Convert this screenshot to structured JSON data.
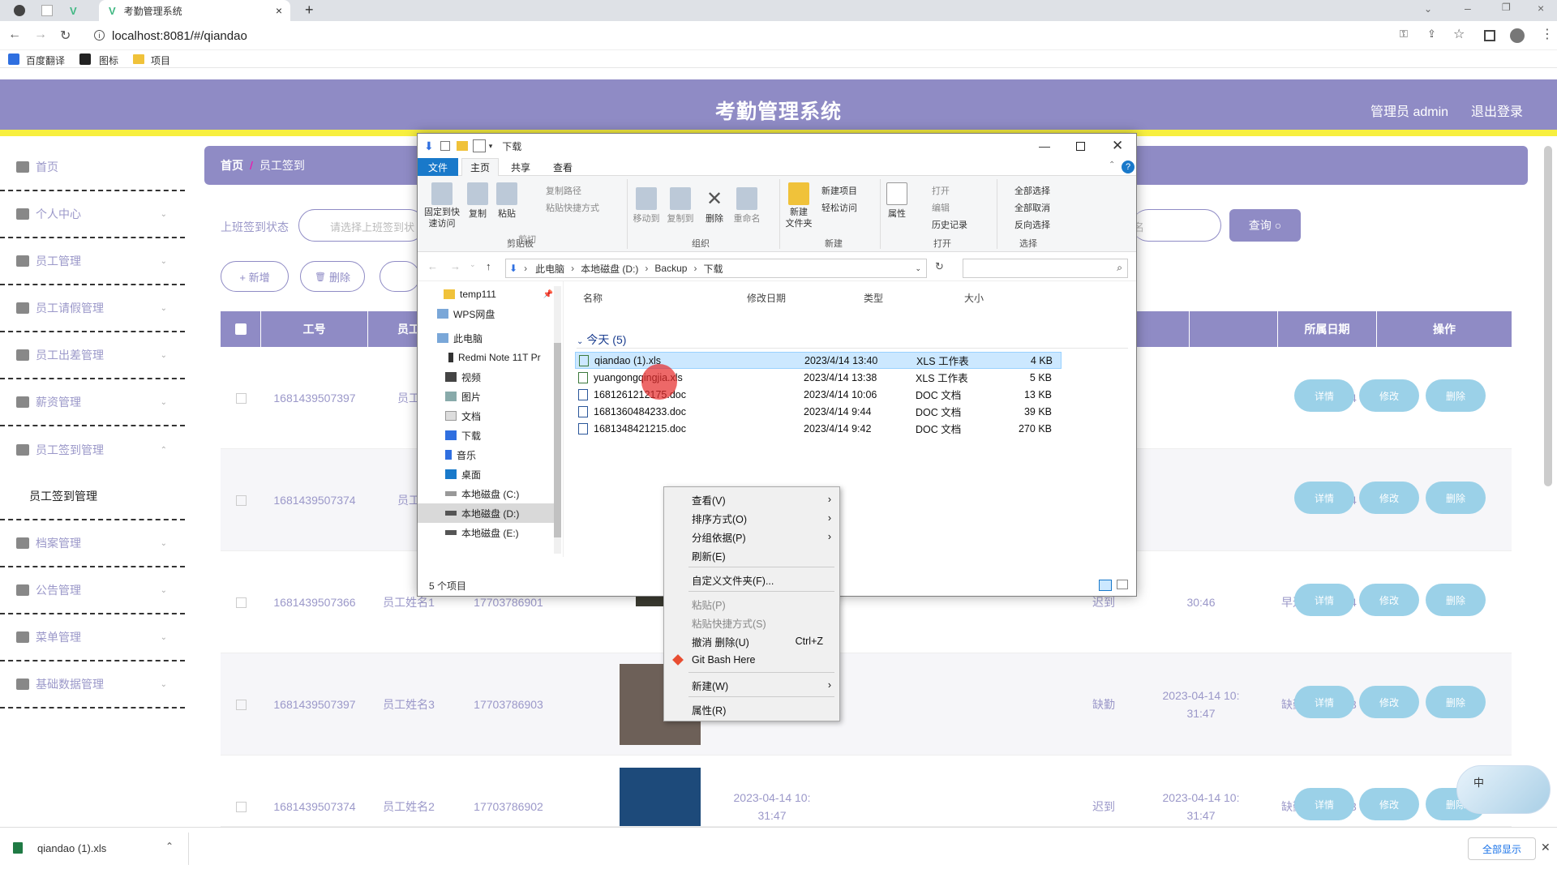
{
  "browser": {
    "tab_title": "考勤管理系统",
    "url": "localhost:8081/#/qiandao",
    "bookmarks": [
      "百度翻译",
      "图标",
      "项目"
    ]
  },
  "app": {
    "title": "考勤管理系统",
    "user": "管理员 admin",
    "logout": "退出登录"
  },
  "sidebar": [
    {
      "label": "首页"
    },
    {
      "label": "个人中心"
    },
    {
      "label": "员工管理"
    },
    {
      "label": "员工请假管理"
    },
    {
      "label": "员工出差管理"
    },
    {
      "label": "薪资管理"
    },
    {
      "label": "员工签到管理"
    },
    {
      "label": "员工签到管理"
    },
    {
      "label": "档案管理"
    },
    {
      "label": "公告管理"
    },
    {
      "label": "菜单管理"
    },
    {
      "label": "基础数据管理"
    }
  ],
  "breadcrumb": {
    "home": "首页",
    "sep": "/",
    "current": "员工签到"
  },
  "filters": {
    "label": "上班签到状态",
    "placeholder": "请选择上班签到状",
    "name_placeholder": "名",
    "query": "查询"
  },
  "toolbar": {
    "add": "+ 新增",
    "delete": "删除"
  },
  "table": {
    "headers": [
      "工号",
      "员工",
      "所属日期",
      "操作"
    ],
    "rows": [
      {
        "id": "1681439507397",
        "name": "员工",
        "phone": "",
        "t1": "",
        "s1": "",
        "t2": "",
        "s2": "",
        "date": "2023-04-14"
      },
      {
        "id": "1681439507374",
        "name": "员工",
        "phone": "",
        "t1": "",
        "s1": "",
        "t2": "",
        "s2": "",
        "date": "2023-04-14"
      },
      {
        "id": "1681439507366",
        "name": "员工姓名1",
        "phone": "17703786901",
        "t1": "",
        "s1": "迟到",
        "t2": "30:46",
        "s2": "早退",
        "date": "2023-04-14"
      },
      {
        "id": "1681439507397",
        "name": "员工姓名3",
        "phone": "17703786903",
        "t1": "",
        "s1": "缺勤",
        "t2": "2023-04-14 10:\n31:47",
        "s2": "缺勤",
        "date": "2023-04-13"
      },
      {
        "id": "1681439507374",
        "name": "员工姓名2",
        "phone": "17703786902",
        "t1": "2023-04-14 10:\n31:47",
        "s1": "迟到",
        "t2": "2023-04-14 10:\n31:47",
        "s2": "缺勤",
        "date": "2023-04-13"
      }
    ],
    "ops": [
      "详情",
      "修改",
      "删除"
    ]
  },
  "explorer": {
    "title": "下载",
    "tabs": [
      "文件",
      "主页",
      "共享",
      "查看"
    ],
    "ribbon": {
      "pin": "固定到快\n速访问",
      "copy": "复制",
      "paste": "粘贴",
      "copy_path": "复制路径",
      "paste_shortcut": "粘贴快捷方式",
      "cut": "剪切",
      "move_to": "移动到",
      "copy_to": "复制到",
      "delete": "删除",
      "rename": "重命名",
      "new_folder": "新建\n文件夹",
      "new_item": "新建项目",
      "easy_access": "轻松访问",
      "properties": "属性",
      "open": "打开",
      "edit": "编辑",
      "history": "历史记录",
      "select_all": "全部选择",
      "select_none": "全部取消",
      "invert": "反向选择",
      "groups": [
        "剪贴板",
        "组织",
        "新建",
        "打开",
        "选择"
      ]
    },
    "path": [
      "此电脑",
      "本地磁盘 (D:)",
      "Backup",
      "下载"
    ],
    "tree": [
      "temp111",
      "WPS网盘",
      "此电脑",
      "Redmi Note 11T Pr",
      "视频",
      "图片",
      "文档",
      "下载",
      "音乐",
      "桌面",
      "本地磁盘 (C:)",
      "本地磁盘 (D:)",
      "本地磁盘 (E:)"
    ],
    "columns": [
      "名称",
      "修改日期",
      "类型",
      "大小"
    ],
    "group": "今天 (5)",
    "files": [
      {
        "name": "qiandao (1).xls",
        "date": "2023/4/14 13:40",
        "type": "XLS 工作表",
        "size": "4 KB"
      },
      {
        "name": "yuangongqingjia.xls",
        "date": "2023/4/14 13:38",
        "type": "XLS 工作表",
        "size": "5 KB"
      },
      {
        "name": "1681261212175.doc",
        "date": "2023/4/14 10:06",
        "type": "DOC 文档",
        "size": "13 KB"
      },
      {
        "name": "1681360484233.doc",
        "date": "2023/4/14 9:44",
        "type": "DOC 文档",
        "size": "39 KB"
      },
      {
        "name": "1681348421215.doc",
        "date": "2023/4/14 9:42",
        "type": "DOC 文档",
        "size": "270 KB"
      }
    ],
    "status": "5 个项目"
  },
  "context_menu": [
    {
      "label": "查看(V)",
      "sub": true
    },
    {
      "label": "排序方式(O)",
      "sub": true
    },
    {
      "label": "分组依据(P)",
      "sub": true
    },
    {
      "label": "刷新(E)"
    },
    {
      "label": "自定义文件夹(F)..."
    },
    {
      "label": "粘贴(P)",
      "disabled": true
    },
    {
      "label": "粘贴快捷方式(S)",
      "disabled": true
    },
    {
      "label": "撤消 删除(U)",
      "shortcut": "Ctrl+Z"
    },
    {
      "label": "Git Bash Here"
    },
    {
      "label": "新建(W)",
      "sub": true
    },
    {
      "label": "属性(R)"
    }
  ],
  "download": {
    "file": "qiandao (1).xls",
    "show_all": "全部显示"
  }
}
